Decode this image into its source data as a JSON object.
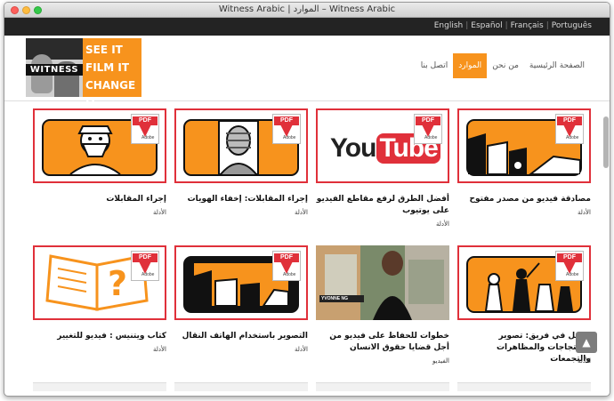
{
  "window": {
    "title": "Witness Arabic | الموارد – Witness Arabic"
  },
  "languages": [
    "English",
    "Español",
    "Français",
    "Português"
  ],
  "logo": {
    "name": "WITNESS",
    "slogan": [
      "SEE IT",
      "FILM IT",
      "CHANGE IT"
    ]
  },
  "nav": [
    {
      "label": "اتصل بنا",
      "active": false
    },
    {
      "label": "الموارد",
      "active": true
    },
    {
      "label": "من نحن",
      "active": false
    },
    {
      "label": "الصفحة الرئيسية",
      "active": false
    }
  ],
  "pdf_badge": {
    "label": "PDF",
    "brand": "Adobe"
  },
  "youtube_logo": {
    "you": "You",
    "tube": "Tube"
  },
  "video_overlay": {
    "name": "YVONNE NG"
  },
  "cards": [
    {
      "title": "إجراء المقابلات",
      "category": "الأدلة"
    },
    {
      "title": "إجراء المقابلات: إخفاء الهويات",
      "category": "الأدلة"
    },
    {
      "title": "أفضل الطرق لرفع مقاطع الفيديو على يوتيوب",
      "category": "الأدلة"
    },
    {
      "title": "مصادقة فيديو من مصدر مفتوح",
      "category": "الأدلة"
    },
    {
      "title": "كتاب ويتنيس : فيديو للتغيير",
      "category": "الأدلة"
    },
    {
      "title": "التصوير باستخدام الهاتف النقال",
      "category": "الأدلة"
    },
    {
      "title": "خطوات للحفاظ على فيديو من أجل قضايا حقوق الانسان",
      "category": "الفيديو"
    },
    {
      "title": "العمل في فريق: تصوير الاحتجاجات والمظاهرات والتجمعات",
      "category": "الأدلة"
    }
  ],
  "scroll_top": {
    "icon": "chevron-up-icon"
  },
  "colors": {
    "accent": "#f7931d",
    "pdf_red": "#e0303a",
    "dark": "#232323"
  }
}
